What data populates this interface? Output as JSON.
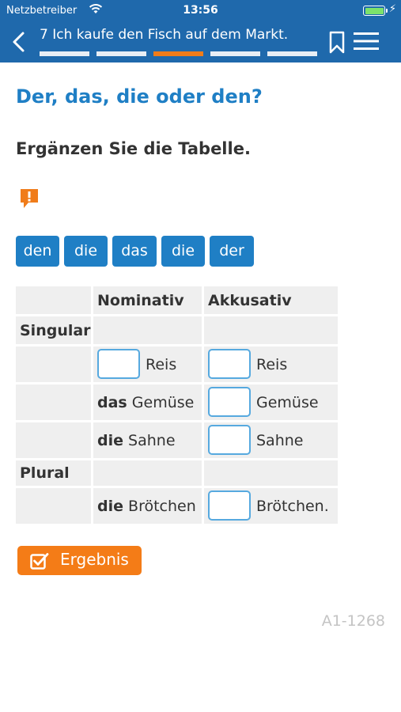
{
  "status_bar": {
    "carrier": "Netzbetreiber",
    "time": "13:56"
  },
  "nav": {
    "title": "7 Ich kaufe den Fisch auf dem Markt.",
    "progress_segments": 5,
    "active_segment": 3,
    "accent_color": "#1f69ac",
    "progress_active_color": "#f07c1a"
  },
  "exercise": {
    "heading": "Der, das, die oder den?",
    "instruction": "Ergänzen Sie die Tabelle.",
    "hint_icon": "exclamation-speech-bubble-icon",
    "word_chips": [
      "den",
      "die",
      "das",
      "die",
      "der"
    ]
  },
  "table": {
    "headers": {
      "col1": "Nominativ",
      "col2": "Akkusativ"
    },
    "groups": {
      "singular": "Singular",
      "plural": "Plural"
    },
    "rows": [
      {
        "nom_article": "",
        "nom_noun": "Reis",
        "akk_noun": "Reis"
      },
      {
        "nom_article": "das",
        "nom_noun": "Gemüse",
        "akk_noun": "Gemüse"
      },
      {
        "nom_article": "die",
        "nom_noun": "Sahne",
        "akk_noun": "Sahne"
      },
      {
        "nom_article": "die",
        "nom_noun": "Brötchen",
        "akk_noun": "Brötchen."
      }
    ]
  },
  "result_button": {
    "label": "Ergebnis",
    "icon": "checkbox-icon"
  },
  "exercise_code": "A1-1268"
}
